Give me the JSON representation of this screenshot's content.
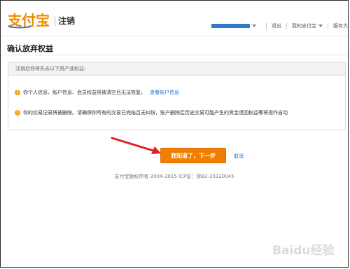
{
  "header": {
    "logo_text": "支付宝",
    "subtitle": "注销",
    "nav": {
      "logout": "退出",
      "my_alipay": "我的支付宝",
      "service": "服务大"
    }
  },
  "page": {
    "title": "确认放弃权益"
  },
  "panel": {
    "heading": "注销后你将失去以下资产或权益:",
    "items": [
      {
        "text": "你个人信息、账户信息、会员权益将被清空且无法恢复。",
        "link": "查看账户信息"
      },
      {
        "text": "你的交易记录将被删除。请确保你所有的交易已完结且无纠纷，账户删除后历史交易可能产生的资金退回权益等将视作自动"
      }
    ]
  },
  "actions": {
    "primary": "我知道了，下一步",
    "cancel": "取消"
  },
  "footer": {
    "copyright": "支付宝版权所有 2004-2015 ICP证：浙B2-20120045"
  },
  "watermark": {
    "text": "Baidu经验"
  },
  "colors": {
    "brand_orange": "#f07e00",
    "link_blue": "#1a6fc9",
    "alipay_blue": "#2f79c8",
    "bullet": "#f3a321",
    "arrow_red": "#e02020"
  }
}
